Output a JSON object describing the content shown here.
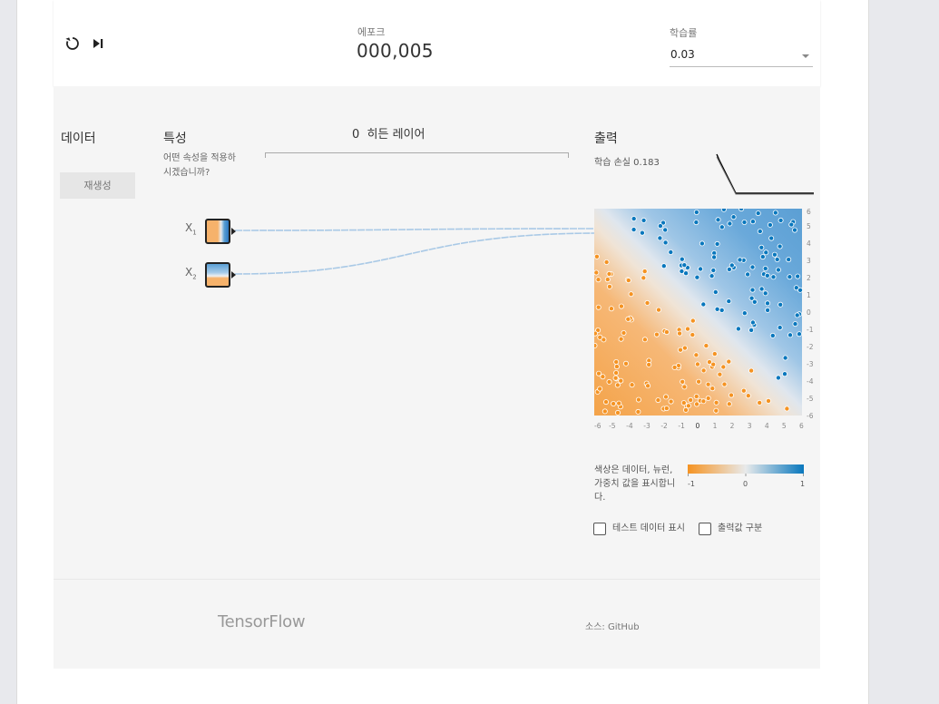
{
  "controls": {
    "reset_icon": "reset-icon",
    "step_icon": "step-icon"
  },
  "epoch": {
    "label": "에포크",
    "value": "000,005"
  },
  "learning_rate": {
    "label": "학습률",
    "value": "0.03"
  },
  "columns": {
    "data_title": "데이터",
    "features_title": "특성",
    "output_title": "출력"
  },
  "data": {
    "regenerate_label": "재생성"
  },
  "features": {
    "question": "어떤 속성을 적용하시겠습니까?",
    "x1": {
      "base": "X",
      "sub": "1"
    },
    "x2": {
      "base": "X",
      "sub": "2"
    }
  },
  "hidden": {
    "count": "0",
    "label": "히든 레이어"
  },
  "output": {
    "loss_label": "학습 손실",
    "loss_value": "0.183",
    "legend_text": "색상은 데이터, 뉴런, 가중치 값을 표시합니다.",
    "scale_min": "-1",
    "scale_mid": "0",
    "scale_max": "1",
    "checkbox_test": "테스트 데이터 표시",
    "checkbox_discrete": "출력값 구분"
  },
  "heatmap": {
    "y_ticks": [
      "6",
      "5",
      "4",
      "3",
      "2",
      "1",
      "0",
      "-1",
      "-2",
      "-3",
      "-4",
      "-5",
      "-6"
    ],
    "x_ticks": [
      "-6",
      "-5",
      "-4",
      "-3",
      "-2",
      "-1",
      "0",
      "1",
      "2",
      "3",
      "4",
      "5",
      "6"
    ]
  },
  "colors": {
    "orange": "#f59322",
    "blue": "#0877bd"
  },
  "footer": {
    "logo": "TensorFlow",
    "source_prefix": "소스:",
    "source_link": "GitHub"
  }
}
